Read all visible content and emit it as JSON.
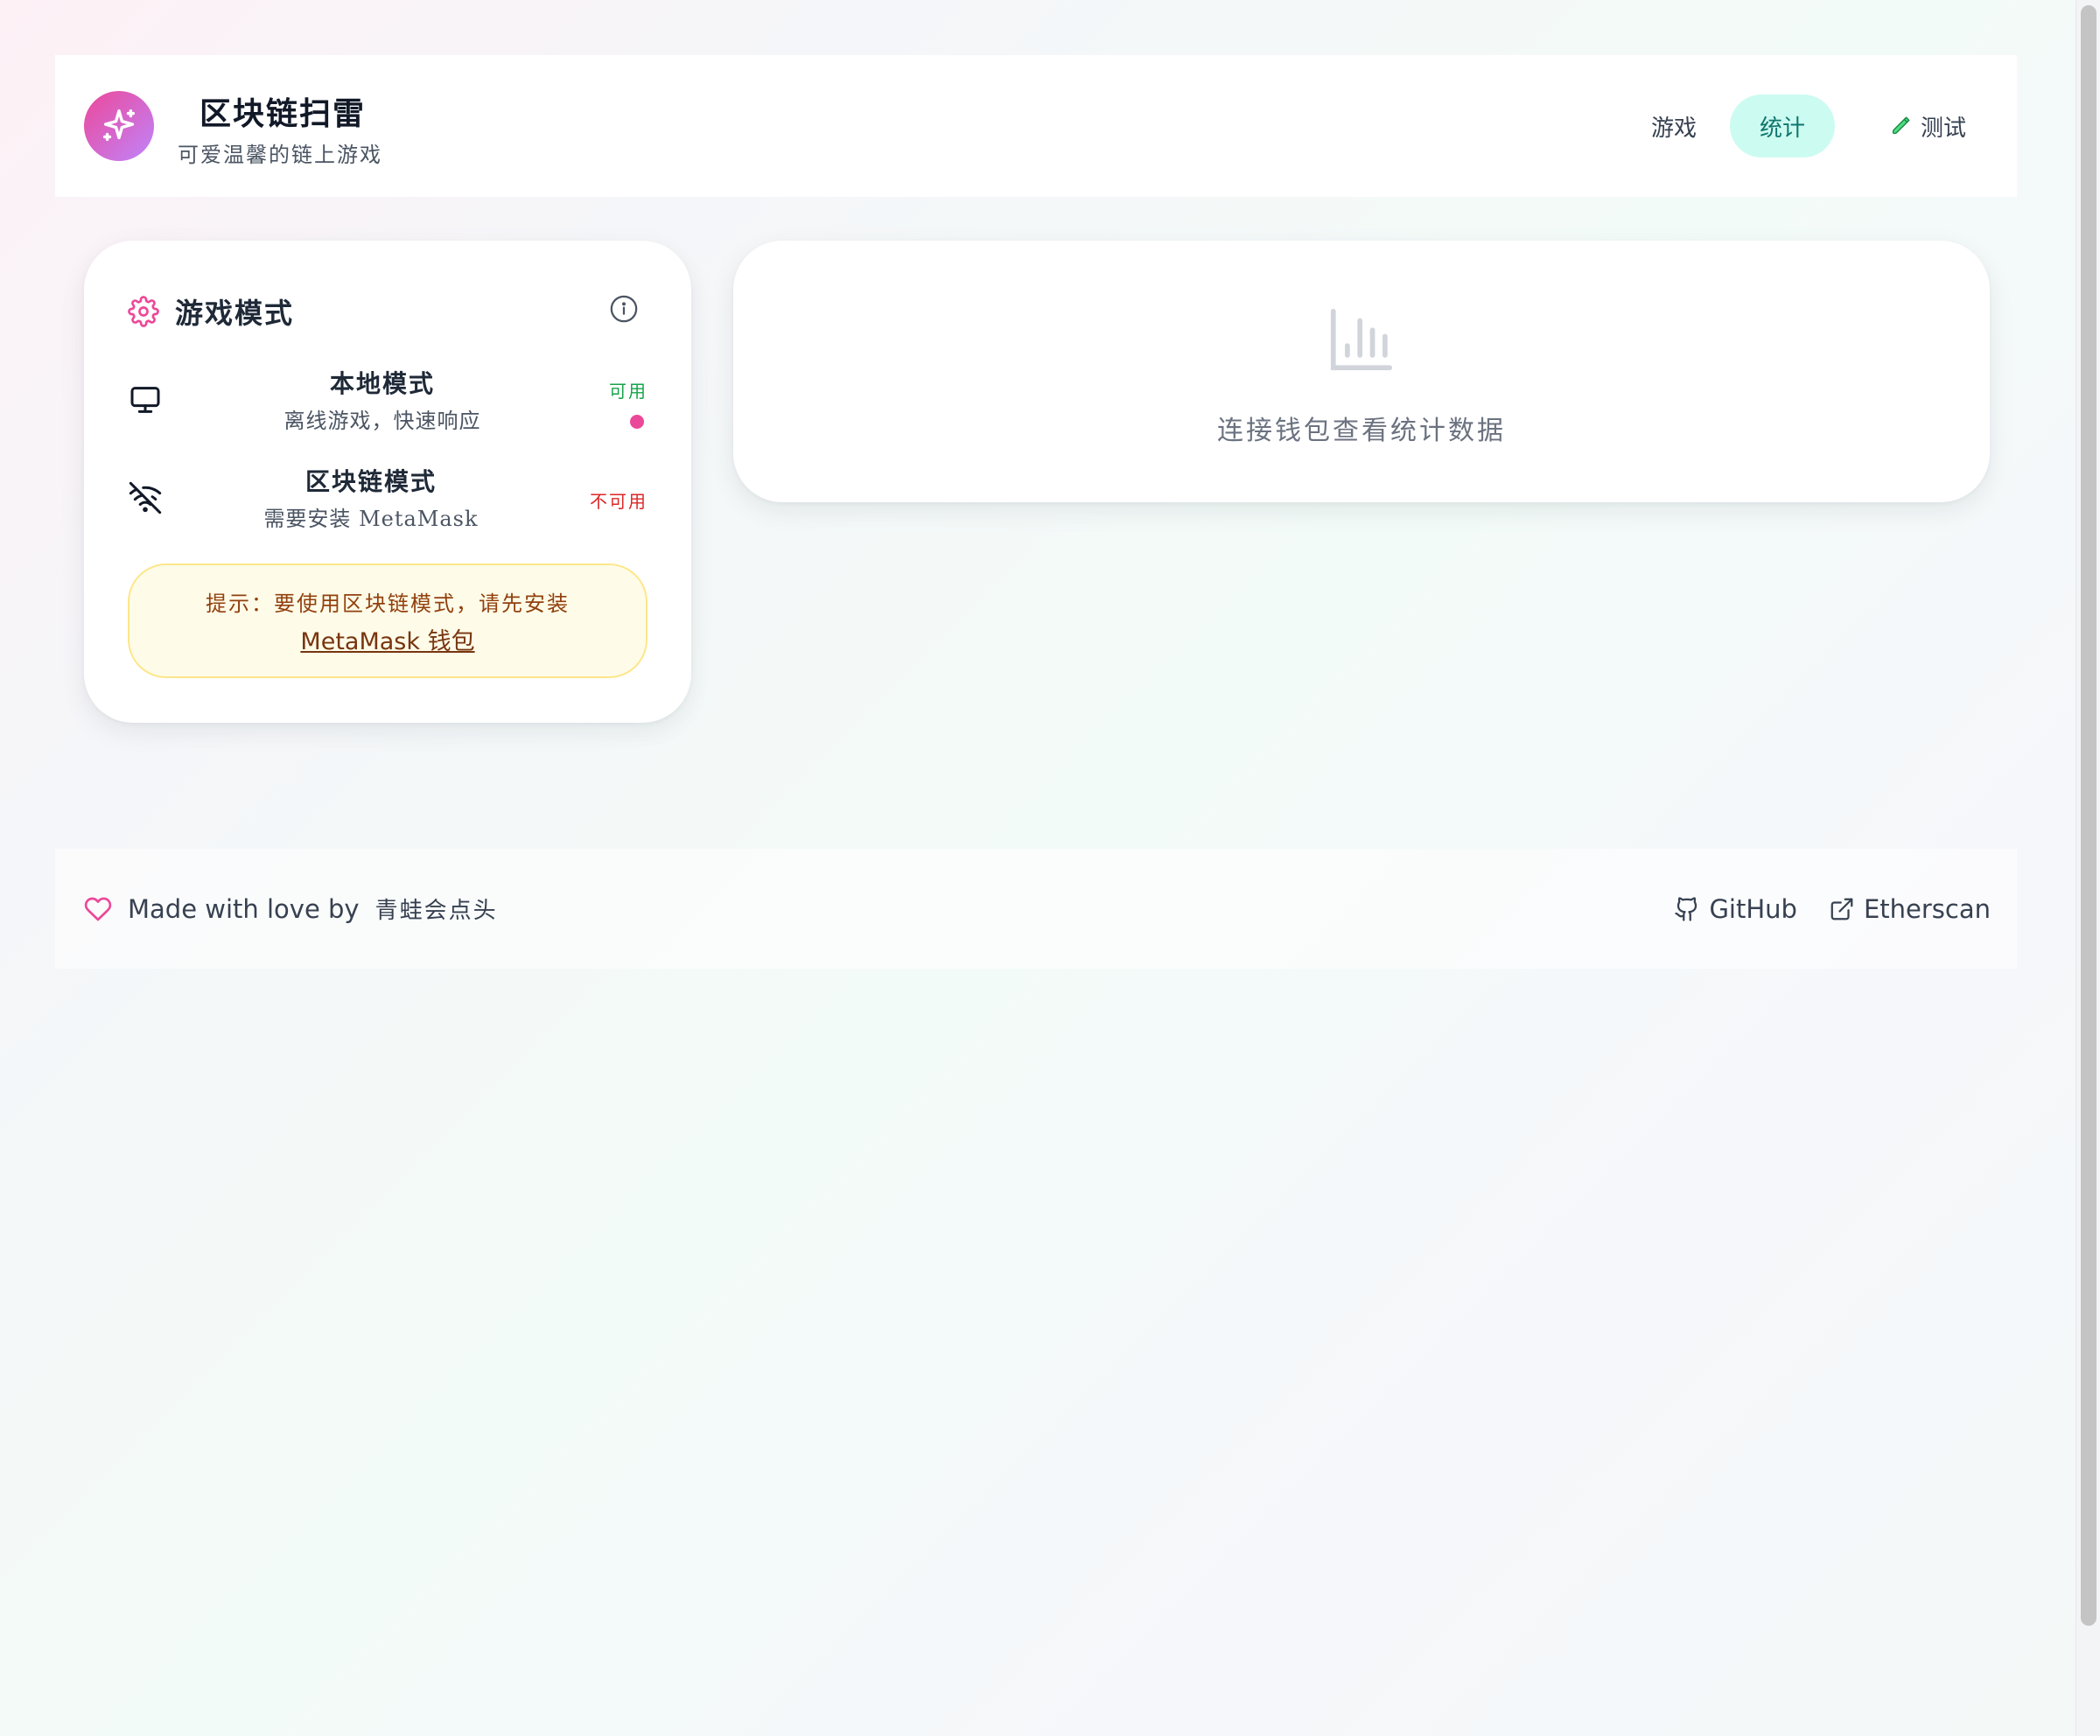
{
  "header": {
    "title": "区块链扫雷",
    "subtitle": "可爱温馨的链上游戏",
    "logo_icon": "sparkle-icon",
    "nav": {
      "game": "游戏",
      "stats": "统计",
      "test": "测试"
    }
  },
  "mode_card": {
    "title": "游戏模式",
    "modes": [
      {
        "name": "本地模式",
        "desc": "离线游戏，快速响应",
        "status": "可用",
        "icon": "monitor-icon",
        "active": true
      },
      {
        "name": "区块链模式",
        "desc": "需要安装 MetaMask",
        "status": "不可用",
        "icon": "wifi-off-icon",
        "active": false
      }
    ],
    "tip": {
      "text": "提示：要使用区块链模式，请先安装",
      "link": "MetaMask 钱包"
    }
  },
  "stats_card": {
    "message": "连接钱包查看统计数据",
    "icon": "bar-chart-icon"
  },
  "footer": {
    "made_with": "Made with love by",
    "author": "青蛙会点头",
    "links": {
      "github": "GitHub",
      "etherscan": "Etherscan"
    }
  },
  "colors": {
    "accent_pink": "#ec4899",
    "active_tab_bg": "#ccfbf1",
    "active_tab_text": "#0f766e",
    "status_ok": "#16a34a",
    "status_no": "#dc2626",
    "tip_bg": "#fefce8"
  }
}
